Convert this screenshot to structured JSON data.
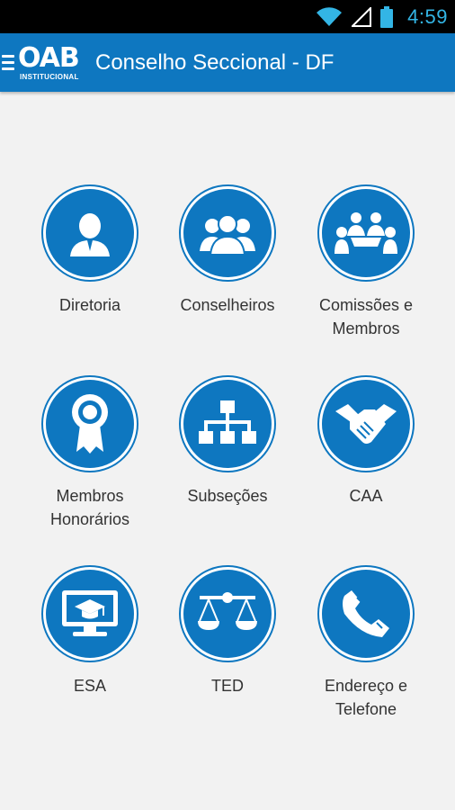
{
  "status_bar": {
    "time": "4:59"
  },
  "header": {
    "logo_text": "OAB",
    "logo_subtext": "INSTITUCIONAL",
    "title": "Conselho Seccional - DF"
  },
  "menu_items": [
    {
      "label": "Diretoria",
      "icon": "person-icon"
    },
    {
      "label": "Conselheiros",
      "icon": "group-icon"
    },
    {
      "label": "Comissões e\nMembros",
      "icon": "meeting-icon"
    },
    {
      "label": "Membros\nHonorários",
      "icon": "award-ribbon-icon"
    },
    {
      "label": "Subseções",
      "icon": "org-chart-icon"
    },
    {
      "label": "CAA",
      "icon": "handshake-icon"
    },
    {
      "label": "ESA",
      "icon": "graduation-monitor-icon"
    },
    {
      "label": "TED",
      "icon": "scales-icon"
    },
    {
      "label": "Endereço e\nTelefone",
      "icon": "phone-icon"
    }
  ],
  "colors": {
    "primary": "#0e77c0",
    "status_bar": "#000000",
    "clock": "#33b5e5",
    "background": "#f2f2f2"
  }
}
